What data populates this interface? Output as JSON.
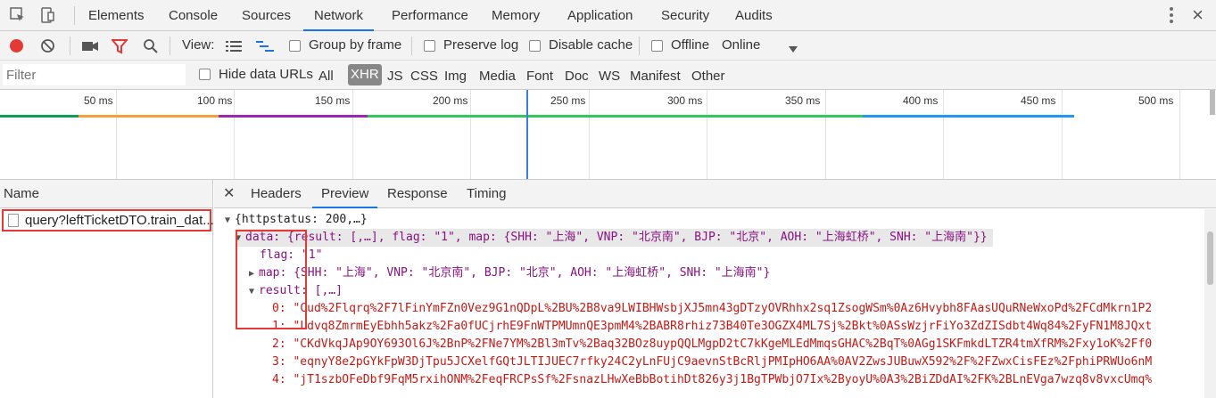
{
  "tabs": [
    "Elements",
    "Console",
    "Sources",
    "Network",
    "Performance",
    "Memory",
    "Application",
    "Security",
    "Audits"
  ],
  "active_tab": "Network",
  "toolbar": {
    "view_label": "View:",
    "group_by_frame": "Group by frame",
    "preserve_log": "Preserve log",
    "disable_cache": "Disable cache",
    "offline": "Offline",
    "throttling": "Online"
  },
  "filter": {
    "placeholder": "Filter",
    "hide_data_urls": "Hide data URLs",
    "types": [
      "All",
      "XHR",
      "JS",
      "CSS",
      "Img",
      "Media",
      "Font",
      "Doc",
      "WS",
      "Manifest",
      "Other"
    ],
    "selected_type": "XHR"
  },
  "timeline": {
    "ticks": [
      "50 ms",
      "100 ms",
      "150 ms",
      "200 ms",
      "250 ms",
      "300 ms",
      "350 ms",
      "400 ms",
      "450 ms",
      "500 ms"
    ]
  },
  "requests": {
    "header": "Name",
    "items": [
      "query?leftTicketDTO.train_dat..."
    ]
  },
  "detail": {
    "tabs": [
      "Headers",
      "Preview",
      "Response",
      "Timing"
    ],
    "active_tab": "Preview",
    "lines": [
      "{httpstatus: 200,…}",
      "data: {result: [,…], flag: \"1\", map: {SHH: \"上海\", VNP: \"北京南\", BJP: \"北京\", AOH: \"上海虹桥\", SNH: \"上海南\"}}",
      "flag: \"1\"",
      "map: {SHH: \"上海\", VNP: \"北京南\", BJP: \"北京\", AOH: \"上海虹桥\", SNH: \"上海南\"}",
      "result: [,…]",
      "0: \"Cud%2Flqrq%2F7lFinYmFZn0Vez9G1nQDpL%2BU%2B8va9LWIBHWsbjXJ5mn43gDTzyOVRhhx2sq1ZsogWSm%0Az6Hvybh8FAasUQuRNeWxoPd%2FCdMkrn1P2",
      "1: \"Ldvq8ZmrmEyEbhh5akz%2Fa0fUCjrhE9FnWTPMUmnQE3pmM4%2BABR8rhiz73B40Te3OGZX4ML7Sj%2Bkt%0ASsWzjrFiYo3ZdZISdbt4Wq84%2FyFN1M8JQxt",
      "2: \"CKdVkqJAp9OY693Ol6J%2BnP%2FNe7YM%2Bl3mTv%2Baq32BOz8uypQQLMgpD2tC7kKgeMLEdMmqsGHAC%2BqT%0AGg1SKFmkdLTZR4tmXfRM%2Fxy1oK%2Ff0",
      "3: \"eqnyY8e2pGYkFpW3DjTpu5JCXelfGQtJLTIJUEC7rfky24C2yLnFUjC9aevnStBcRljPMIpHO6AA%0AV2ZwsJUBuwX592%2F%2FZwxCisFEz%2FphiPRWUo6nM",
      "4: \"jT1szbOFeDbf9FqM5rxihONM%2FeqFRCPsSf%2FsnazLHwXeBbBotihDt826y3j1BgTPWbjO7Ix%2ByoyU%0A3%2BiZDdAI%2FK%2BLnEVga7wzq8v8vxcUmq%"
    ]
  },
  "colors": {
    "record": "#e53935",
    "filter_icon": "#e53935",
    "active_underline": "#1a73e8",
    "key": "#881280",
    "string": "#c41a16",
    "highlight_box": "#e53935"
  }
}
